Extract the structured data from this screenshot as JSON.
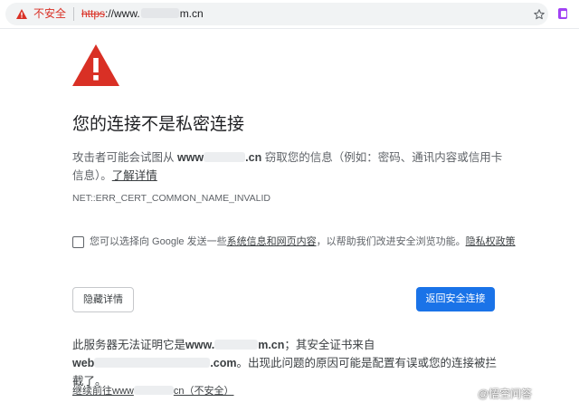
{
  "address_bar": {
    "security_label": "不安全",
    "url_scheme": "https",
    "url_prefix": "://www.",
    "url_suffix": "m.cn"
  },
  "page": {
    "heading": "您的连接不是私密连接",
    "desc_before": "攻击者可能会试图从 ",
    "desc_domain_prefix": "www",
    "desc_domain_suffix": ".cn",
    "desc_after": " 窃取您的信息（例如：密码、通讯内容或信用卡信息）。",
    "learn_more": "了解详情",
    "error_code": "NET::ERR_CERT_COMMON_NAME_INVALID",
    "optin_before": "您可以选择向 Google 发送一些",
    "optin_link": "系统信息和网页内容",
    "optin_after": "，以帮助我们改进安全浏览功能。",
    "privacy_policy": "隐私权政策",
    "hide_details_button": "隐藏详情",
    "back_to_safety_button": "返回安全连接",
    "detail_before": "此服务器无法证明它是",
    "detail_domain_prefix": "www.",
    "detail_domain_suffix": "m.cn",
    "detail_mid": "；其安全证书来自",
    "detail_issuer_prefix": "web",
    "detail_issuer_suffix": ".com",
    "detail_after": "。出现此问题的原因可能是配置有误或您的连接被拦截了。",
    "proceed_prefix": "继续前往www",
    "proceed_suffix": "cn（不安全）"
  },
  "watermark": "@悟空问答",
  "colors": {
    "danger_red": "#d93025",
    "primary_blue": "#1a73e8",
    "text_dark": "#202124",
    "text_muted": "#5f6368"
  },
  "icons": {
    "security": "warning-triangle-icon",
    "bookmark": "star-icon",
    "extension": "extension-icon",
    "page": "danger-triangle-icon"
  }
}
